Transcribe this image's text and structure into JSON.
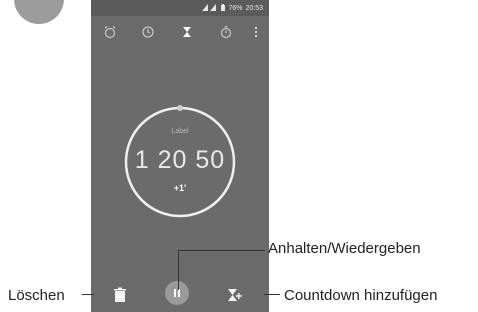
{
  "status_bar": {
    "battery": "76%",
    "time": "20:53"
  },
  "tabs": [
    {
      "icon": "alarm-icon"
    },
    {
      "icon": "clock-icon"
    },
    {
      "icon": "hourglass-icon"
    },
    {
      "icon": "stopwatch-icon"
    },
    {
      "icon": "more-vert-icon"
    }
  ],
  "timer": {
    "label": "Label",
    "time": "1 20 50",
    "add_minute": "+1'"
  },
  "bottom": {
    "delete_icon": "trash-icon",
    "pause_icon": "pause-icon",
    "add_icon": "hourglass-add-icon"
  },
  "callouts": {
    "pause": "Anhalten/Wiedergeben",
    "delete": "Löschen",
    "add": "Countdown hinzufügen"
  },
  "colors": {
    "screen": "#6b6b6b",
    "ring": "#f0f0f0",
    "pause_button": "#9a9a9a"
  }
}
